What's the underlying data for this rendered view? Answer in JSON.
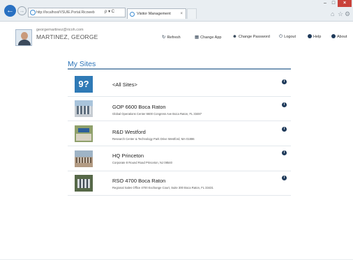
{
  "browser": {
    "back_icon": "back-arrow-icon",
    "forward_icon": "forward-arrow-icon",
    "address": "http://localhost/VSUIE.Portal.Ricoweb",
    "address_tools": "ρ ▾ C",
    "tab_title": "Visitor Management",
    "tab_close": "×",
    "window_controls": {
      "minimize": "–",
      "maximize": "□",
      "close": "×"
    },
    "toolbar_icons": [
      "home-icon",
      "star-icon",
      "gear-icon"
    ]
  },
  "user": {
    "email": "georgemartinez@ricoh.com",
    "name": "MARTINEZ, GEORGE"
  },
  "header_links": [
    {
      "label": "Refresh",
      "icon": "refresh-icon",
      "glyph": "↻"
    },
    {
      "label": "Change App",
      "icon": "apps-icon",
      "glyph": "▦"
    },
    {
      "label": "Change Password",
      "icon": "user-icon",
      "glyph": "☻"
    },
    {
      "label": "Logout",
      "icon": "power-icon",
      "glyph": "⏻"
    },
    {
      "label": "Help",
      "icon": "help-icon",
      "glyph": "?"
    },
    {
      "label": "About",
      "icon": "info-icon",
      "glyph": "i"
    }
  ],
  "main": {
    "title": "My Sites",
    "sites": [
      {
        "name": "<All Sites>",
        "address": "",
        "thumb_text": "9?",
        "info": "i"
      },
      {
        "name": "GOP 6600 Boca Raton",
        "address": "Global Operations Center 6600 Congress Ave Boca Raton, FL 33487",
        "info": "i"
      },
      {
        "name": "R&D Westford",
        "address": "Research Center & Technology Park Drive Westford, MA 01886",
        "info": "i"
      },
      {
        "name": "HQ Princeton",
        "address": "Corporate 8 Round Road Princeton, NJ 08540",
        "info": "i"
      },
      {
        "name": "RSO 4700 Boca Raton",
        "address": "Regional Sales Office 4700 Exchange Court, Suite 300 Boca Raton, FL 33431",
        "info": "i"
      }
    ]
  },
  "colors": {
    "accent": "#2a73b8",
    "title_rule": "#7a9ab8",
    "info_badge": "#1f3a5a",
    "close_button": "#c9423a"
  }
}
